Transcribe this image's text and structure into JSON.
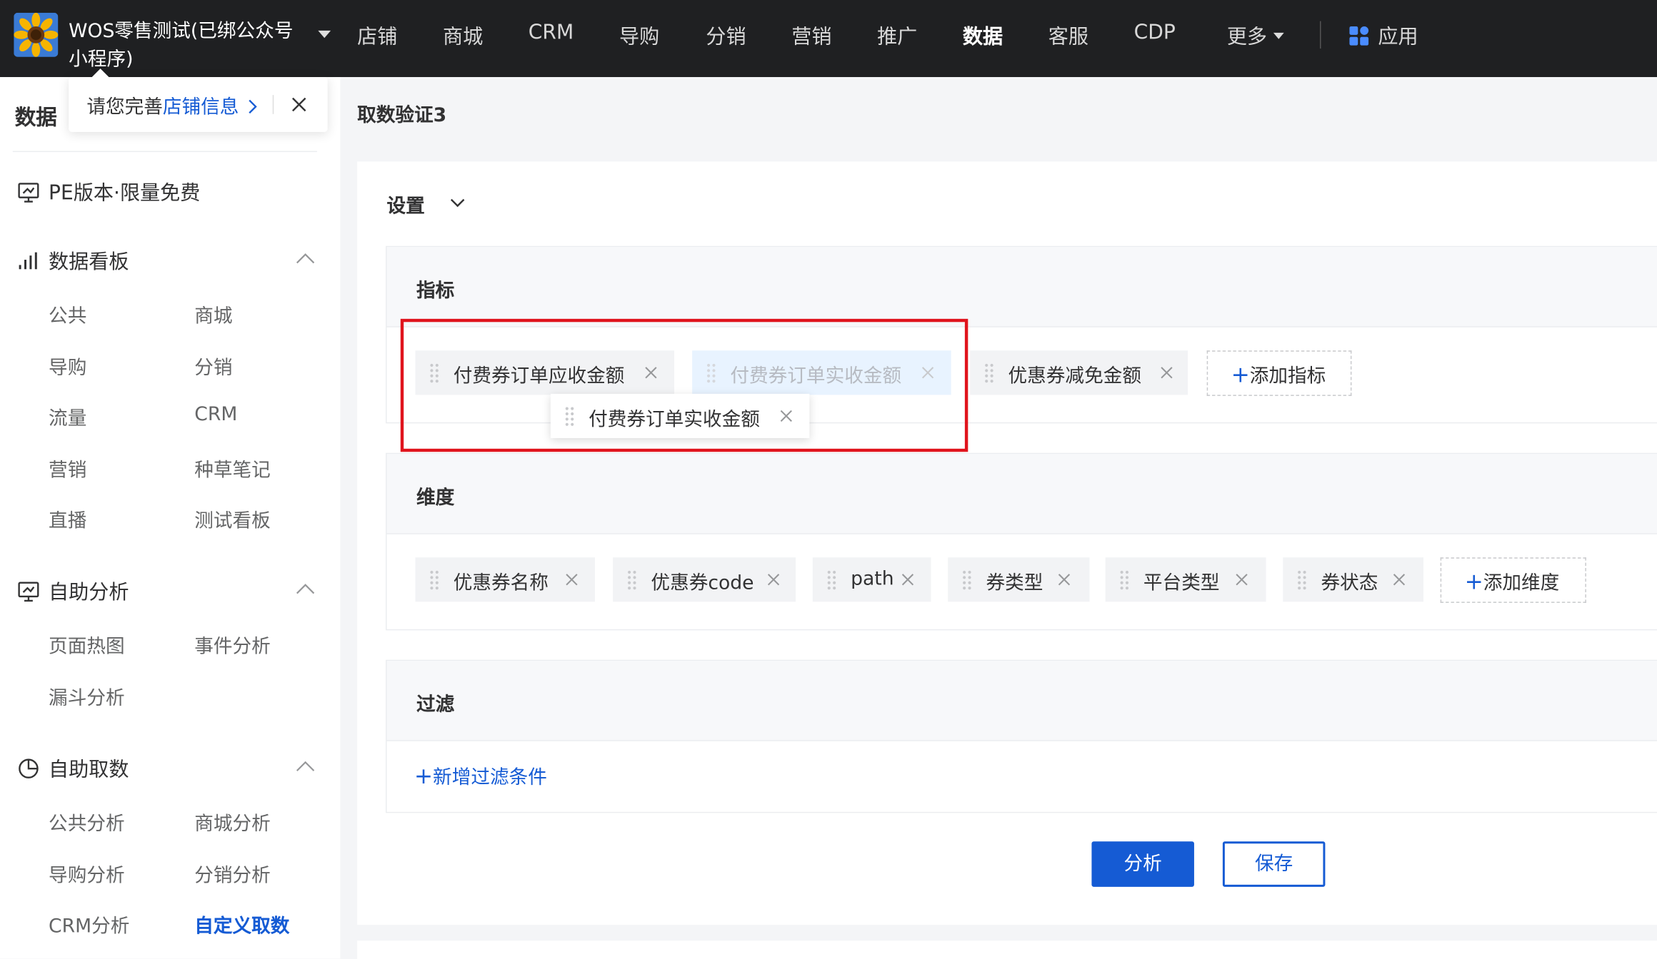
{
  "topbar": {
    "shop_name": "WOS零售测试(已绑公众号小程序)",
    "nav": [
      "店铺",
      "商城",
      "CRM",
      "导购",
      "分销",
      "营销",
      "推广",
      "数据",
      "客服",
      "CDP"
    ],
    "active_nav": "数据",
    "more_label": "更多",
    "apps_label": "应用"
  },
  "tooltip": {
    "prefix": "请您完善",
    "link": "店铺信息"
  },
  "sidebar": {
    "title": "数据",
    "pe_label": "PE版本·限量免费",
    "groups": [
      {
        "label": "数据看板",
        "icon": "bar-chart-icon",
        "items": [
          "公共",
          "商城",
          "导购",
          "分销",
          "流量",
          "CRM",
          "营销",
          "种草笔记",
          "直播",
          "测试看板"
        ]
      },
      {
        "label": "自助分析",
        "icon": "presentation-icon",
        "items": [
          "页面热图",
          "事件分析",
          "漏斗分析"
        ]
      },
      {
        "label": "自助取数",
        "icon": "pie-chart-icon",
        "items": [
          "公共分析",
          "商城分析",
          "导购分析",
          "分销分析",
          "CRM分析",
          "自定义取数"
        ]
      }
    ],
    "active_item": "自定义取数"
  },
  "main": {
    "page_title": "取数验证3",
    "settings_label": "设置",
    "metrics": {
      "title": "指标",
      "tags": [
        "付费券订单应收金额",
        "付费券订单实收金额",
        "优惠券减免金额"
      ],
      "dragging_tag": "付费券订单实收金额",
      "add_label": "添加指标"
    },
    "dimensions": {
      "title": "维度",
      "tags": [
        "优惠券名称",
        "优惠券code",
        "path",
        "券类型",
        "平台类型",
        "券状态"
      ],
      "add_label": "添加维度"
    },
    "filter": {
      "title": "过滤",
      "add_label": "新增过滤条件"
    },
    "analyze_label": "分析",
    "save_label": "保存"
  },
  "colors": {
    "accent": "#155bd4",
    "topbar_bg": "#1f2022",
    "highlight_box": "#e0141d"
  }
}
